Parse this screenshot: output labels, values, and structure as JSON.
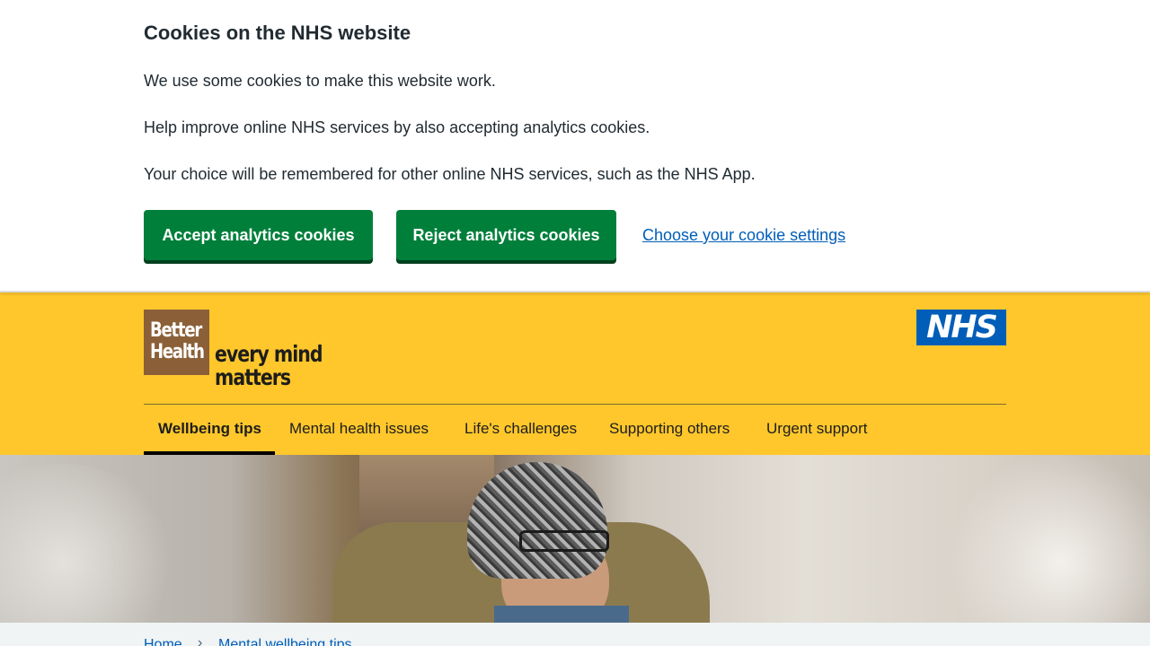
{
  "cookie_banner": {
    "title": "Cookies on the NHS website",
    "paragraph_1": "We use some cookies to make this website work.",
    "paragraph_2": "Help improve online NHS services by also accepting analytics cookies.",
    "paragraph_3": "Your choice will be remembered for other online NHS services, such as the NHS App.",
    "accept_label": "Accept analytics cookies",
    "reject_label": "Reject analytics cookies",
    "settings_link": "Choose your cookie settings"
  },
  "header": {
    "brand_box_line1": "Better",
    "brand_box_line2": "Health",
    "brand_text_line1": "every mind",
    "brand_text_line2": "matters",
    "nhs_logo": "NHS"
  },
  "nav": {
    "items": [
      {
        "label": "Wellbeing tips",
        "active": true
      },
      {
        "label": "Mental health issues",
        "active": false
      },
      {
        "label": "Life's challenges",
        "active": false
      },
      {
        "label": "Supporting others",
        "active": false
      },
      {
        "label": "Urgent support",
        "active": false
      }
    ]
  },
  "breadcrumb": {
    "items": [
      "Home",
      "Mental wellbeing tips"
    ],
    "separator": "›"
  },
  "colors": {
    "header_yellow": "#ffc72c",
    "button_green": "#007f3b",
    "link_blue": "#005eb8",
    "nhs_blue": "#005eb8",
    "brand_brown": "#8b6039"
  }
}
